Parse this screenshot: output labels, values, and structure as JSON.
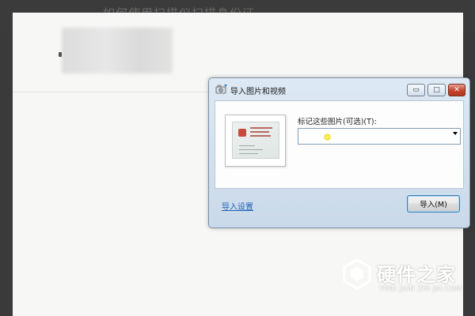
{
  "background": {
    "title": "如何使用扫描仪扫描身份证"
  },
  "dialog": {
    "title": "导入图片和视频",
    "window_buttons": {
      "minimize": "▭",
      "maximize": "□",
      "close": "✕"
    },
    "tag_label": "标记这些图片(可选)(T):",
    "tag_value": "",
    "import_settings_link": "导入设置",
    "import_button": "导入(M)",
    "thumbnail_icon": "id-card-thumbnail"
  },
  "watermark": {
    "title": "硬件之家",
    "subtitle": "YING JIAN ZHI JIA.COM"
  },
  "colors": {
    "accent_link": "#1f5fb8",
    "dialog_frame": "#cad9e9",
    "close_button": "#c4432c"
  }
}
